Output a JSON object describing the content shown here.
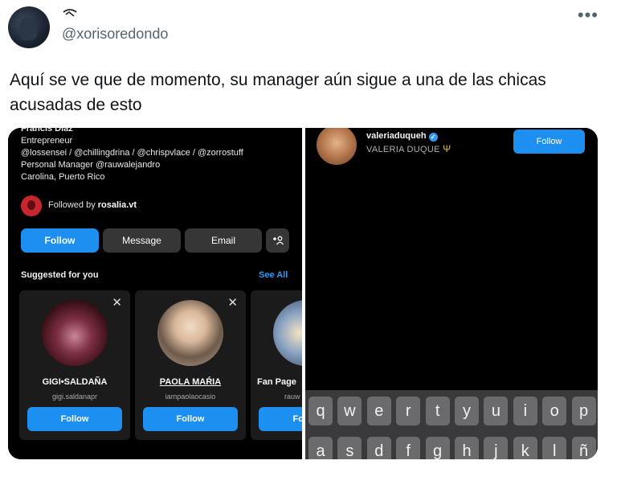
{
  "tweet": {
    "handle": "@xorisoredondo",
    "text": "Aquí se ve que de momento, su manager aún sigue a una de las chicas acusadas de esto",
    "more_icon": "more-horizontal-icon"
  },
  "left_screenshot": {
    "bio": {
      "name": "Francis Diaz",
      "category": "Entrepreneur",
      "links": "@lossensei / @chillingdrina / @chrispvlace / @zorrostuff",
      "personal_manager": "Personal Manager @rauwalejandro",
      "location": "Carolina, Puerto Rico"
    },
    "followed_by_prefix": "Followed by ",
    "followed_by_user": "rosalia.vt",
    "buttons": {
      "follow": "Follow",
      "message": "Message",
      "email": "Email",
      "add_person_icon": "+☺"
    },
    "suggested_title": "Suggested for you",
    "see_all": "See All",
    "cards": [
      {
        "name": "GIGI•SALDAÑA",
        "username": "gigi.saldanapr",
        "button": "Follow"
      },
      {
        "name": "PAOLA MAŔIA",
        "username": "iampaolaocasio",
        "button": "Follow"
      },
      {
        "name": "Fan Page",
        "username": "rauw",
        "button": "Fo"
      }
    ]
  },
  "right_screenshot": {
    "username": "valeriaduqueh",
    "display_name": "VALERIA DUQUE",
    "trident": "Ψ",
    "follow": "Follow",
    "keyboard_row1": [
      "q",
      "w",
      "e",
      "r",
      "t",
      "y",
      "u",
      "i",
      "o",
      "p"
    ],
    "keyboard_row2": [
      "a",
      "s",
      "d",
      "f",
      "g",
      "h",
      "j",
      "k",
      "l",
      "ñ"
    ]
  },
  "colors": {
    "follow_blue": "#1d8ff0",
    "see_all_blue": "#2c9bf7",
    "handle_grey": "#536471"
  }
}
